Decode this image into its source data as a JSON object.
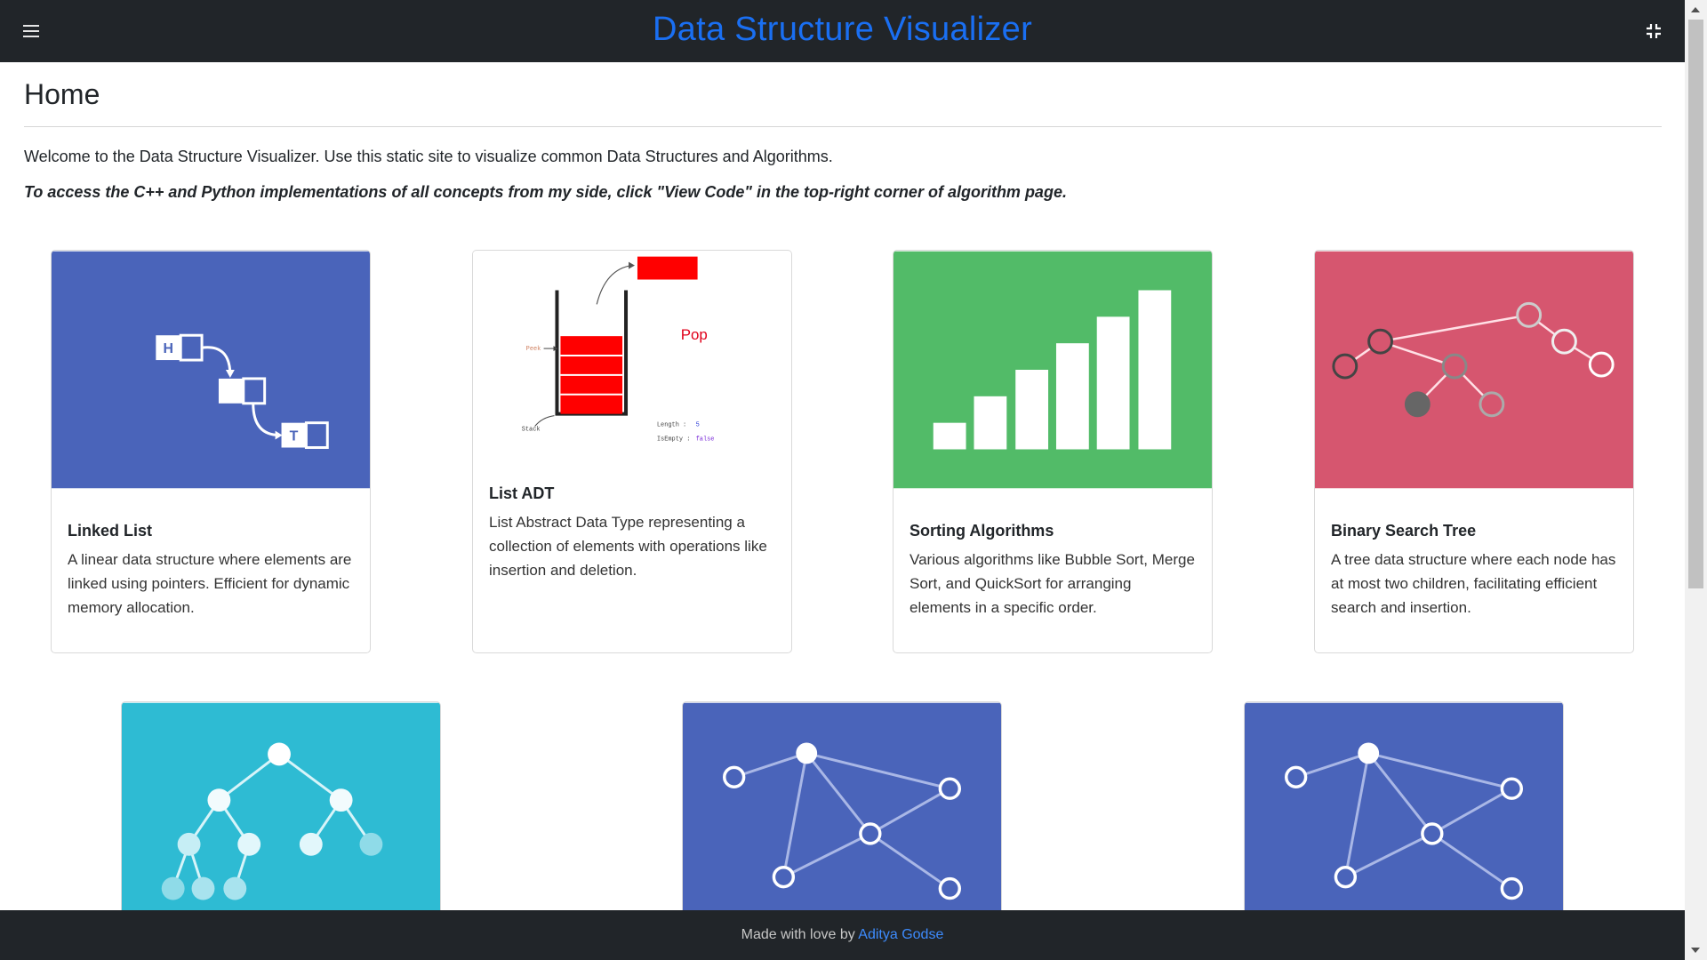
{
  "navbar": {
    "title": "Data Structure Visualizer",
    "menu_icon": "hamburger-icon",
    "collapse_icon": "compress-icon"
  },
  "page": {
    "title": "Home",
    "intro": "Welcome to the Data Structure Visualizer. Use this static site to visualize common Data Structures and Algorithms.",
    "note": "To access the C++ and Python implementations of all concepts from my side, click \"View Code\" in the top-right corner of algorithm page."
  },
  "cards": [
    {
      "title": "Linked List",
      "description": "A linear data structure where elements are linked using pointers. Efficient for dynamic memory allocation.",
      "image_color": "#4a64ba"
    },
    {
      "title": "List ADT",
      "description": "List Abstract Data Type representing a collection of elements with operations like insertion and deletion.",
      "image_color": "#ffffff",
      "image_labels": {
        "pop": "Pop",
        "peek": "Peek",
        "stack": "Stack",
        "length_label": "Length :",
        "length_value": "5",
        "isempty_label": "IsEmpty :",
        "isempty_value": "false"
      }
    },
    {
      "title": "Sorting Algorithms",
      "description": "Various algorithms like Bubble Sort, Merge Sort, and QuickSort for arranging elements in a specific order.",
      "image_color": "#52bb68"
    },
    {
      "title": "Binary Search Tree",
      "description": "A tree data structure where each node has at most two children, facilitating efficient search and insertion.",
      "image_color": "#d6566f"
    },
    {
      "image_color": "#2ebbd3"
    },
    {
      "image_color": "#4a64ba"
    },
    {
      "image_color": "#4a64ba"
    }
  ],
  "linked_list_labels": {
    "head": "H",
    "tail": "T"
  },
  "footer": {
    "text": "Made with love by ",
    "author": "Aditya Godse"
  }
}
